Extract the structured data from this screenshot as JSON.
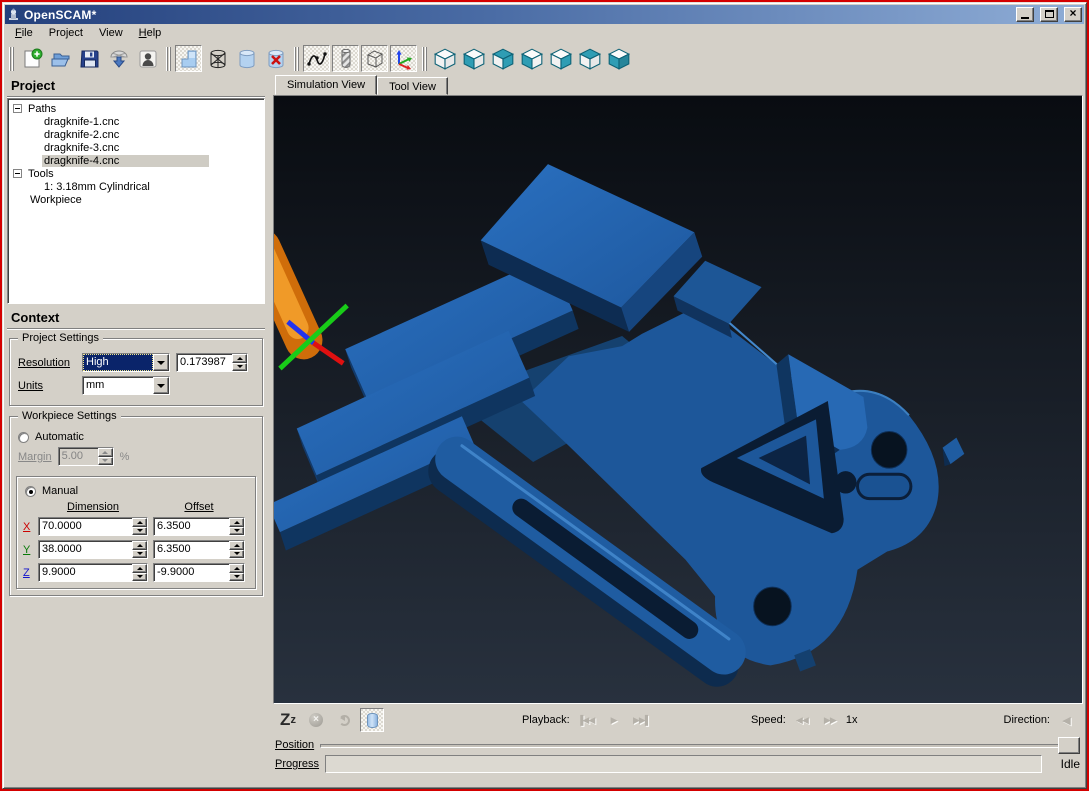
{
  "window": {
    "title": "OpenSCAM*",
    "controls": {
      "minimize": "minimize",
      "maximize": "maximize",
      "close": "×"
    }
  },
  "menu": {
    "items": [
      {
        "label": "File"
      },
      {
        "label": "Project"
      },
      {
        "label": "View"
      },
      {
        "label": "Help"
      }
    ]
  },
  "toolbar": {
    "groups": [
      {
        "buttons": [
          "new-file-icon",
          "open-project-icon",
          "save-project-icon",
          "export-surface-icon",
          "user-icon"
        ]
      },
      {
        "buttons": [
          "cut-workpiece-view-icon",
          "wire-workpiece-icon",
          "solid-workpiece-icon",
          "hide-workpiece-icon"
        ]
      },
      {
        "buttons": [
          "show-toolpath-icon",
          "show-tool-icon",
          "show-bounds-icon",
          "show-axes-icon"
        ]
      },
      {
        "buttons": [
          "view-isometric-icon",
          "view-front-icon",
          "view-back-icon",
          "view-left-icon",
          "view-right-icon",
          "view-top-icon",
          "view-bottom-icon"
        ]
      }
    ]
  },
  "tabs": {
    "items": [
      {
        "label": "Simulation View",
        "active": true
      },
      {
        "label": "Tool View",
        "active": false
      }
    ]
  },
  "project_panel": {
    "title": "Project",
    "tree": [
      {
        "label": "Paths"
      },
      {
        "label": "dragknife-1.cnc"
      },
      {
        "label": "dragknife-2.cnc"
      },
      {
        "label": "dragknife-3.cnc"
      },
      {
        "label": "dragknife-4.cnc",
        "selected": true
      },
      {
        "label": "Tools"
      },
      {
        "label": "1: 3.18mm Cylindrical"
      },
      {
        "label": "Workpiece"
      }
    ]
  },
  "context_panel": {
    "title": "Context",
    "project_settings": {
      "legend": "Project Settings",
      "resolution_label": "Resolution",
      "resolution_value": "High",
      "resolution_number": "0.173987",
      "units_label": "Units",
      "units_value": "mm"
    },
    "workpiece_settings": {
      "legend": "Workpiece Settings",
      "automatic_label": "Automatic",
      "margin_label": "Margin",
      "margin_value": "5.00",
      "margin_unit": "%",
      "manual_label": "Manual",
      "dimension_header": "Dimension",
      "offset_header": "Offset",
      "axes": [
        {
          "axis": "X",
          "dimension": "70.0000",
          "offset": "6.3500"
        },
        {
          "axis": "Y",
          "dimension": "38.0000",
          "offset": "6.3500"
        },
        {
          "axis": "Z",
          "dimension": "9.9000",
          "offset": "-9.9000"
        }
      ]
    }
  },
  "playbar": {
    "zz_large": "Z",
    "zz_small": "z",
    "playback_label": "Playback:",
    "speed_label": "Speed:",
    "speed_value": "1x",
    "direction_label": "Direction:"
  },
  "statusbar": {
    "position_label": "Position",
    "progress_label": "Progress",
    "state": "Idle"
  },
  "colors": {
    "titlebar_left": "#24407c",
    "titlebar_right": "#8fadd6",
    "panel_face": "#d4d0c8",
    "selection_navy": "#0a246a",
    "model_blue_top": "#2468b4",
    "model_blue_side": "#10335e",
    "tool_orange": "#e8831c",
    "axis_x_red": "#e01010",
    "axis_y_green": "#18cc18",
    "axis_z_blue": "#2233ee"
  }
}
